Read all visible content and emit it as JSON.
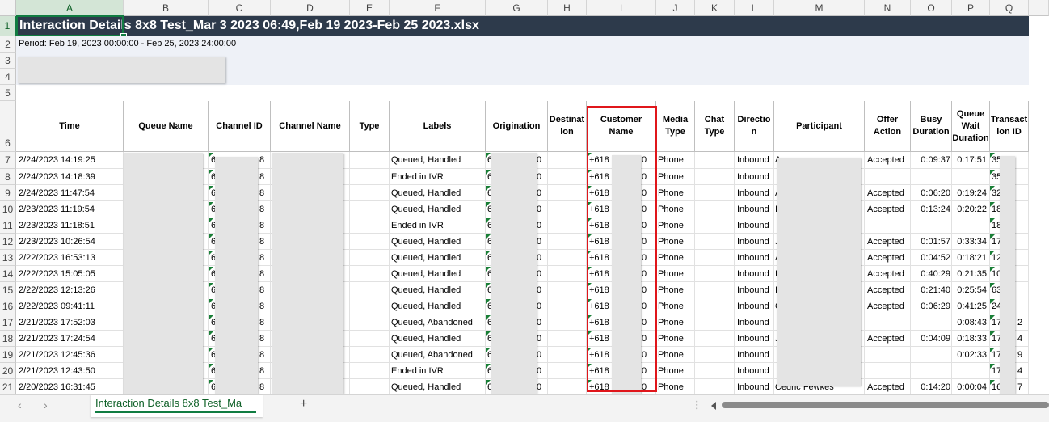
{
  "columns": [
    "A",
    "B",
    "C",
    "D",
    "E",
    "F",
    "G",
    "H",
    "I",
    "J",
    "K",
    "L",
    "M",
    "N",
    "O",
    "P",
    "Q"
  ],
  "row_numbers": [
    "1",
    "2",
    "3",
    "4",
    "5",
    "6",
    "7",
    "8",
    "9",
    "10",
    "11",
    "12",
    "13",
    "14",
    "15",
    "16",
    "17",
    "18",
    "19",
    "20",
    "21"
  ],
  "sheet": {
    "title": "Interaction Details 8x8 Test_Mar 3 2023 06:49,Feb 19 2023-Feb 25 2023.xlsx",
    "period": "Period: Feb 19, 2023 00:00:00 - Feb 25, 2023 24:00:00"
  },
  "headers": [
    "Time",
    "Queue Name",
    "Channel ID",
    "Channel Name",
    "Type",
    "Labels",
    "Origination",
    "Destinat\nion",
    "Customer\nName",
    "Media\nType",
    "Chat\nType",
    "Directio\nn",
    "Participant",
    "Offer\nAction",
    "Busy\nDuration",
    "Queue\nWait\nDuration",
    "Transact\nion ID"
  ],
  "rows": [
    {
      "time": "2/24/2023 14:19:25",
      "channel": "6",
      "channel_end": "8",
      "labels": "Queued, Handled",
      "orig": "6",
      "orig_end": "0",
      "cust": "+618",
      "cust_end": "0",
      "media": "Phone",
      "dir": "Inbound",
      "dir_end": "A",
      "offer": "Accepted",
      "busy": "0:09:37",
      "wait": "0:17:51",
      "txn": "35"
    },
    {
      "time": "2/24/2023 14:18:39",
      "channel": "6",
      "channel_end": "8",
      "labels": "Ended in IVR",
      "orig": "6",
      "orig_end": "0",
      "cust": "+618",
      "cust_end": "0",
      "media": "Phone",
      "dir": "Inbound",
      "dir_end": "",
      "offer": "",
      "busy": "",
      "wait": "",
      "txn": "35"
    },
    {
      "time": "2/24/2023 11:47:54",
      "channel": "6",
      "channel_end": "8",
      "labels": "Queued, Handled",
      "orig": "6",
      "orig_end": "0",
      "cust": "+618",
      "cust_end": "0",
      "media": "Phone",
      "dir": "Inbound",
      "dir_end": "A",
      "offer": "Accepted",
      "busy": "0:06:20",
      "wait": "0:19:24",
      "txn": "32"
    },
    {
      "time": "2/23/2023 11:19:54",
      "channel": "6",
      "channel_end": "8",
      "labels": "Queued, Handled",
      "orig": "6",
      "orig_end": "0",
      "cust": "+618",
      "cust_end": "0",
      "media": "Phone",
      "dir": "Inbound",
      "dir_end": "I",
      "offer": "Accepted",
      "busy": "0:13:24",
      "wait": "0:20:22",
      "txn": "18"
    },
    {
      "time": "2/23/2023 11:18:51",
      "channel": "6",
      "channel_end": "8",
      "labels": "Ended in IVR",
      "orig": "6",
      "orig_end": "0",
      "cust": "+618",
      "cust_end": "0",
      "media": "Phone",
      "dir": "Inbound",
      "dir_end": "",
      "offer": "",
      "busy": "",
      "wait": "",
      "txn": "18"
    },
    {
      "time": "2/23/2023 10:26:54",
      "channel": "6",
      "channel_end": "8",
      "labels": "Queued, Handled",
      "orig": "6",
      "orig_end": "0",
      "cust": "+618",
      "cust_end": "0",
      "media": "Phone",
      "dir": "Inbound",
      "dir_end": "J",
      "offer": "Accepted",
      "busy": "0:01:57",
      "wait": "0:33:34",
      "txn": "17"
    },
    {
      "time": "2/22/2023 16:53:13",
      "channel": "6",
      "channel_end": "8",
      "labels": "Queued, Handled",
      "orig": "6",
      "orig_end": "0",
      "cust": "+618",
      "cust_end": "0",
      "media": "Phone",
      "dir": "Inbound",
      "dir_end": "A",
      "offer": "Accepted",
      "busy": "0:04:52",
      "wait": "0:18:21",
      "txn": "12"
    },
    {
      "time": "2/22/2023 15:05:05",
      "channel": "6",
      "channel_end": "8",
      "labels": "Queued, Handled",
      "orig": "6",
      "orig_end": "0",
      "cust": "+618",
      "cust_end": "0",
      "media": "Phone",
      "dir": "Inbound",
      "dir_end": "I",
      "offer": "Accepted",
      "busy": "0:40:29",
      "wait": "0:21:35",
      "txn": "10"
    },
    {
      "time": "2/22/2023 12:13:26",
      "channel": "6",
      "channel_end": "8",
      "labels": "Queued, Handled",
      "orig": "6",
      "orig_end": "0",
      "cust": "+618",
      "cust_end": "0",
      "media": "Phone",
      "dir": "Inbound",
      "dir_end": "I",
      "offer": "Accepted",
      "busy": "0:21:40",
      "wait": "0:25:54",
      "txn": "63"
    },
    {
      "time": "2/22/2023 09:41:11",
      "channel": "6",
      "channel_end": "8",
      "labels": "Queued, Handled",
      "orig": "6",
      "orig_end": "0",
      "cust": "+618",
      "cust_end": "0",
      "media": "Phone",
      "dir": "Inbound",
      "dir_end": "C",
      "offer": "Accepted",
      "busy": "0:06:29",
      "wait": "0:41:25",
      "txn": "24"
    },
    {
      "time": "2/21/2023 17:52:03",
      "channel": "6",
      "channel_end": "8",
      "labels": "Queued, Abandoned",
      "orig": "6",
      "orig_end": "0",
      "cust": "+618",
      "cust_end": "0",
      "media": "Phone",
      "dir": "Inbound",
      "dir_end": "",
      "offer": "",
      "busy": "",
      "wait": "0:08:43",
      "txn": "17",
      "txn_end": "2"
    },
    {
      "time": "2/21/2023 17:24:54",
      "channel": "6",
      "channel_end": "8",
      "labels": "Queued, Handled",
      "orig": "6",
      "orig_end": "0",
      "cust": "+618",
      "cust_end": "0",
      "media": "Phone",
      "dir": "Inbound",
      "dir_end": "J",
      "offer": "Accepted",
      "busy": "0:04:09",
      "wait": "0:18:33",
      "txn": "17",
      "txn_end": "4"
    },
    {
      "time": "2/21/2023 12:45:36",
      "channel": "6",
      "channel_end": "8",
      "labels": "Queued, Abandoned",
      "orig": "6",
      "orig_end": "0",
      "cust": "+618",
      "cust_end": "0",
      "media": "Phone",
      "dir": "Inbound",
      "dir_end": "",
      "offer": "",
      "busy": "",
      "wait": "0:02:33",
      "txn": "17",
      "txn_end": "9"
    },
    {
      "time": "2/21/2023 12:43:50",
      "channel": "6",
      "channel_end": "8",
      "labels": "Ended in IVR",
      "orig": "6",
      "orig_end": "0",
      "cust": "+618",
      "cust_end": "0",
      "media": "Phone",
      "dir": "Inbound",
      "dir_end": "",
      "offer": "",
      "busy": "",
      "wait": "",
      "txn": "17",
      "txn_end": "4"
    },
    {
      "time": "2/20/2023 16:31:45",
      "channel": "6",
      "channel_end": "8",
      "labels": "Queued, Handled",
      "orig": "6",
      "orig_end": "0",
      "cust": "+618",
      "cust_end": "0",
      "media": "Phone",
      "dir": "Inbound",
      "dir_end": "Cedric Fewkes",
      "offer": "Accepted",
      "busy": "0:14:20",
      "wait": "0:00:04",
      "txn": "16",
      "txn_end": "7"
    }
  ],
  "tabs": {
    "active": "Interaction Details 8x8 Test_Ma",
    "prev": "‹",
    "next": "›",
    "add": "+",
    "more": "⋮"
  },
  "colors": {
    "title_bg": "#2d3a4b",
    "band_bg": "#eef1f7",
    "selection": "#107c41",
    "highlight_box": "#e0161b",
    "note_triangle": "#1a7f37"
  }
}
